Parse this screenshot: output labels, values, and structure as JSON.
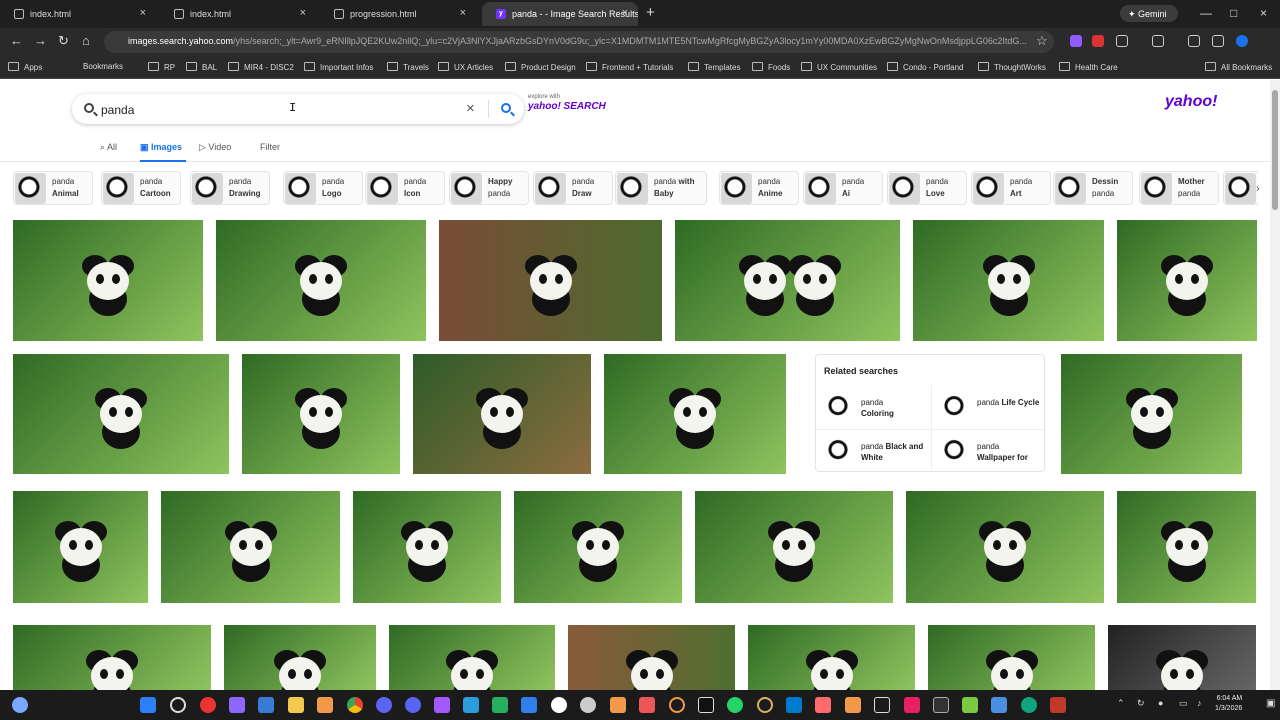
{
  "browser": {
    "tabs": [
      {
        "title": "index.html"
      },
      {
        "title": "index.html"
      },
      {
        "title": "progression.html"
      },
      {
        "title": "panda - - Image Search Results"
      }
    ],
    "url_host": "images.search.yahoo.com",
    "url_path": "/yhs/search;_ylt=Awr9_eRNIllpJQE2KUw2nllQ;_ylu=c2VjA3NlYXJjaARzbGsDYnV0dG9u;_ylc=X1MDMTM1MTE5NTcwMgRfcgMyBGZyA3locy1mYy00MDA0XzEwBGZyMgNwOnMsdjppLG06c2ItdG...",
    "gemini_label": "Gemini",
    "bookmarks": [
      "Apps",
      "Bookmarks",
      "RP",
      "BAL",
      "MIR4 - DISC2",
      "Important Infos",
      "Travels",
      "UX Articles",
      "Product Design",
      "Frontend + Tutorials",
      "Templates",
      "Foods",
      "UX Communities",
      "Condo - Portland",
      "ThoughtWorks",
      "Health Care",
      "All Bookmarks"
    ]
  },
  "search": {
    "query": "panda",
    "explore_prefix": "explore with",
    "explore_brand": "yahoo! SEARCH",
    "brand": "yahoo!"
  },
  "vertical_tabs": [
    "All",
    "Images",
    "Video",
    "Filter"
  ],
  "suggestions": [
    {
      "prefix": "panda",
      "term": "Animal"
    },
    {
      "prefix": "panda",
      "term": "Cartoon"
    },
    {
      "prefix": "panda",
      "term": "Drawing"
    },
    {
      "prefix": "panda",
      "term": "Logo"
    },
    {
      "prefix": "panda",
      "term": "Icon"
    },
    {
      "prefix": "Happy",
      "term": "panda"
    },
    {
      "prefix": "panda",
      "term": "Draw"
    },
    {
      "prefix": "panda",
      "term": "with Baby"
    },
    {
      "prefix": "panda",
      "term": "Anime"
    },
    {
      "prefix": "panda",
      "term": "Ai"
    },
    {
      "prefix": "panda",
      "term": "Love"
    },
    {
      "prefix": "panda",
      "term": "Art"
    },
    {
      "prefix": "Dessin",
      "term": "panda"
    },
    {
      "prefix": "Mother",
      "term": "panda"
    }
  ],
  "related": {
    "title": "Related searches",
    "items": [
      {
        "prefix": "panda",
        "term": "Coloring"
      },
      {
        "prefix": "panda",
        "term": "Life Cycle"
      },
      {
        "prefix": "panda",
        "term": "Black and White"
      },
      {
        "prefix": "panda",
        "term": "Wallpaper for"
      }
    ]
  },
  "clock": {
    "time": "6:04 AM",
    "date": "1/3/2026"
  }
}
